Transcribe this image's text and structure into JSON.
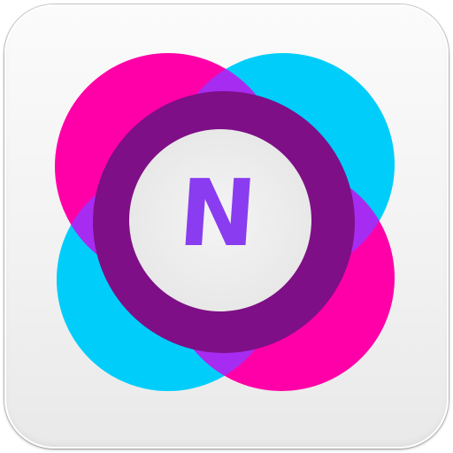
{
  "app_icon": {
    "letter": "N",
    "colors": {
      "magenta": "#ff00a8",
      "cyan": "#00cdfa",
      "violet": "#a72cf1",
      "ring": "#7e0f86",
      "letter": "#8a3cf0",
      "tile": "#f4f4f4"
    }
  }
}
